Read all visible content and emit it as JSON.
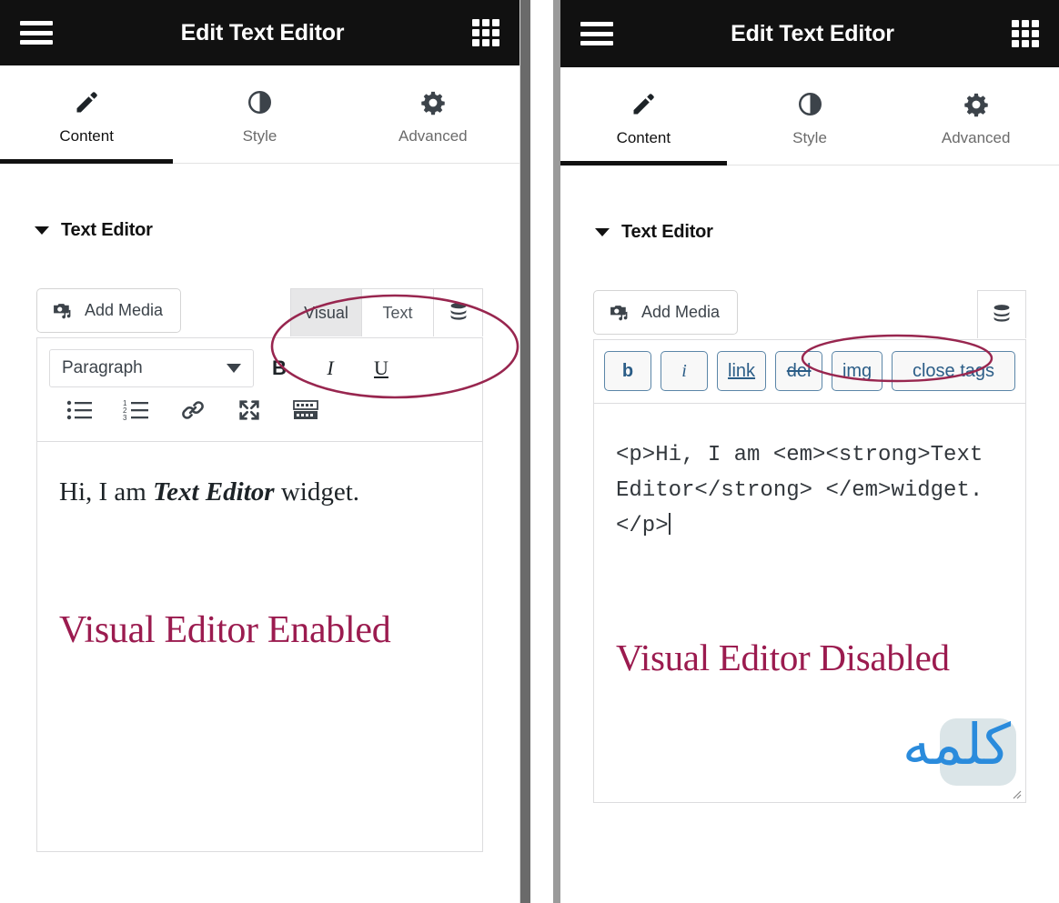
{
  "theme": {
    "topbar_bg": "#111111",
    "accent_maroon": "#9b1b4f",
    "annotation_stroke": "#98264f",
    "quicktag_blue": "#2b5d87",
    "watermark_blue": "#2a8bdc"
  },
  "panels": [
    {
      "id": "left",
      "mode": "visual",
      "topbar": {
        "title": "Edit Text Editor",
        "menu_icon": "hamburger-menu-icon",
        "apps_icon": "apps-grid-icon"
      },
      "tabs": [
        {
          "label": "Content",
          "icon": "pencil-icon",
          "active": true
        },
        {
          "label": "Style",
          "icon": "contrast-icon",
          "active": false
        },
        {
          "label": "Advanced",
          "icon": "gear-icon",
          "active": false
        }
      ],
      "section": {
        "title": "Text Editor",
        "caret": "caret-down-icon",
        "expanded": true
      },
      "add_media_label": "Add Media",
      "editor_tabs": [
        {
          "label": "Visual",
          "active": true
        },
        {
          "label": "Text",
          "active": false
        }
      ],
      "db_icon_label": "database-stack-icon",
      "sparkle_icon_label": "sparkle-ai-icon",
      "format_select": {
        "value": "Paragraph"
      },
      "format_buttons": [
        {
          "label": "B",
          "name": "bold-button"
        },
        {
          "label": "I",
          "name": "italic-button"
        },
        {
          "label": "U",
          "name": "underline-button"
        }
      ],
      "toolbar_icons": [
        "bulleted-list-icon",
        "numbered-list-icon",
        "insert-link-icon",
        "fullscreen-icon",
        "toolbar-toggle-icon"
      ],
      "rendered": {
        "line_prefix": "Hi, I am ",
        "line_emphasis": "Text Editor",
        "line_suffix": " widget."
      },
      "status_text": "Visual Editor Enabled"
    },
    {
      "id": "right",
      "mode": "text",
      "topbar": {
        "title": "Edit Text Editor",
        "menu_icon": "hamburger-menu-icon",
        "apps_icon": "apps-grid-icon"
      },
      "tabs": [
        {
          "label": "Content",
          "icon": "pencil-icon",
          "active": true
        },
        {
          "label": "Style",
          "icon": "contrast-icon",
          "active": false
        },
        {
          "label": "Advanced",
          "icon": "gear-icon",
          "active": false
        }
      ],
      "section": {
        "title": "Text Editor",
        "caret": "caret-down-icon",
        "expanded": true
      },
      "add_media_label": "Add Media",
      "db_icon_label": "database-stack-icon",
      "sparkle_icon_label": "sparkle-ai-icon",
      "quicktags": [
        {
          "label": "b",
          "style": "bold"
        },
        {
          "label": "i",
          "style": "italic"
        },
        {
          "label": "link",
          "style": "underline"
        },
        {
          "label": "del",
          "style": "strike"
        },
        {
          "label": "img",
          "style": "plain"
        },
        {
          "label": "close tags",
          "style": "plain"
        }
      ],
      "code_value": "<p>Hi, I am <em><strong>Text Editor</strong> </em>widget.</p>",
      "status_text": "Visual Editor Disabled",
      "watermark_text": "كلمه"
    }
  ],
  "annotations": [
    {
      "name": "ellipse-highlight-editor-tabs",
      "target": "visual-text-switcher"
    },
    {
      "name": "ellipse-highlight-missing-tabs",
      "target": "absent-switcher-area"
    }
  ]
}
